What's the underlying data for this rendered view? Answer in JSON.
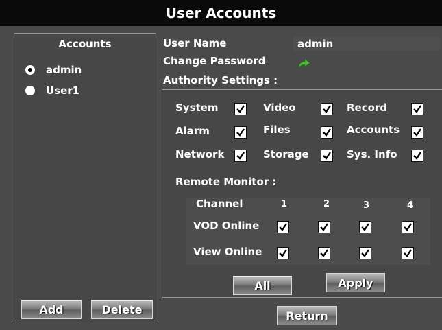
{
  "window": {
    "title": "User Accounts"
  },
  "accounts": {
    "title": "Accounts",
    "items": [
      {
        "label": "admin",
        "selected": true
      },
      {
        "label": "User1",
        "selected": false
      }
    ],
    "add_label": "Add",
    "delete_label": "Delete"
  },
  "user": {
    "name_label": "User Name",
    "name_value": "admin",
    "change_password_label": "Change Password",
    "authority_label": "Authority Settings :"
  },
  "authority": {
    "items": [
      {
        "label": "System",
        "checked": true
      },
      {
        "label": "Video",
        "checked": true
      },
      {
        "label": "Record",
        "checked": true
      },
      {
        "label": "Alarm",
        "checked": true
      },
      {
        "label": "Files",
        "checked": true
      },
      {
        "label": "Accounts",
        "checked": true
      },
      {
        "label": "Network",
        "checked": true
      },
      {
        "label": "Storage",
        "checked": true
      },
      {
        "label": "Sys. Info",
        "checked": true
      }
    ],
    "remote_monitor_label": "Remote Monitor :",
    "channel_label": "Channel",
    "channels": [
      "1",
      "2",
      "3",
      "4"
    ],
    "vod_online_label": "VOD Online",
    "view_online_label": "View Online",
    "all_label": "All",
    "apply_label": "Apply"
  },
  "footer": {
    "return_label": "Return"
  },
  "icons": {
    "change_password": "green-arrow-icon"
  },
  "colors": {
    "title_bar": "#0a0a0a",
    "background": "#4a4a4a",
    "arrow": "#4fbf3a"
  }
}
